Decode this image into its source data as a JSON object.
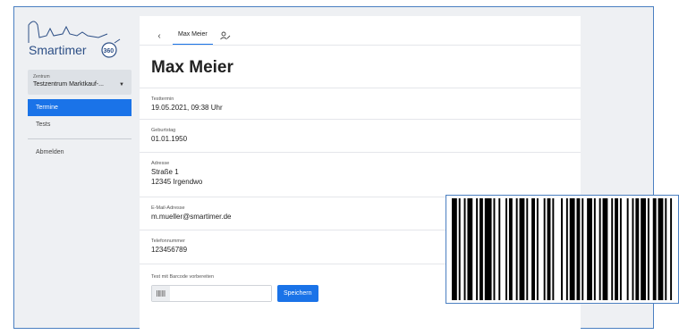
{
  "brand": {
    "logo_text": "Smartimer",
    "logo_badge": "360"
  },
  "sidebar": {
    "center_label": "Zentrum",
    "center_value": "Testzentrum Marktkauf-...",
    "items": [
      {
        "label": "Termine",
        "active": true
      },
      {
        "label": "Tests",
        "active": false
      },
      {
        "label": "Abmelden",
        "active": false
      }
    ]
  },
  "header": {
    "back_icon": "‹",
    "tab_label": "Max Meier",
    "user_edit_icon": "user-edit-icon"
  },
  "person": {
    "name": "Max Meier",
    "fields": [
      {
        "label": "Testtermin",
        "lines": [
          "19.05.2021, 09:38 Uhr"
        ]
      },
      {
        "label": "Geburtstag",
        "lines": [
          "01.01.1950"
        ]
      },
      {
        "label": "Adresse",
        "lines": [
          "Straße 1",
          "12345 Irgendwo"
        ]
      },
      {
        "label": "E-Mail-Adresse",
        "lines": [
          "m.mueller@smartimer.de"
        ]
      },
      {
        "label": "Telefonnummer",
        "lines": [
          "123456789"
        ]
      }
    ]
  },
  "barcode_form": {
    "label": "Test mit Barcode vorbereiten",
    "value": "",
    "placeholder": "",
    "save_label": "Speichern"
  },
  "colors": {
    "accent": "#1a73e8",
    "frame_border": "#4a7fc1",
    "background": "#eef0f3"
  }
}
